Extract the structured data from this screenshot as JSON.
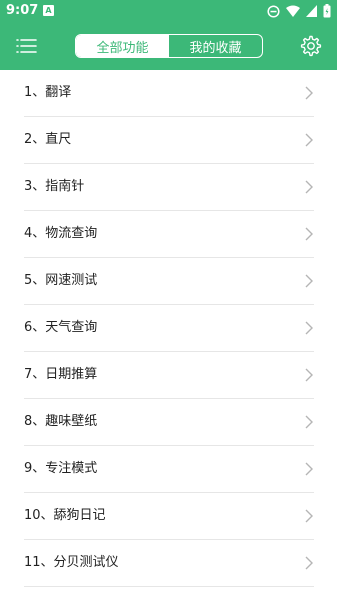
{
  "status_bar": {
    "time": "9:07",
    "notification_letter": "A",
    "icons": [
      "do-not-disturb-icon",
      "wifi-icon",
      "signal-icon",
      "battery-icon"
    ]
  },
  "header": {
    "tabs": [
      {
        "label": "全部功能",
        "active": true
      },
      {
        "label": "我的收藏",
        "active": false
      }
    ],
    "menu_icon": "list-menu-icon",
    "settings_icon": "gear-icon"
  },
  "colors": {
    "accent": "#3cb878",
    "divider": "#e6e6e6",
    "text": "#222222",
    "chevron": "#b5b5b5"
  },
  "items": [
    {
      "label": "1、翻译"
    },
    {
      "label": "2、直尺"
    },
    {
      "label": "3、指南针"
    },
    {
      "label": "4、物流查询"
    },
    {
      "label": "5、网速测试"
    },
    {
      "label": "6、天气查询"
    },
    {
      "label": "7、日期推算"
    },
    {
      "label": "8、趣味壁纸"
    },
    {
      "label": "9、专注模式"
    },
    {
      "label": "10、舔狗日记"
    },
    {
      "label": "11、分贝测试仪"
    }
  ]
}
